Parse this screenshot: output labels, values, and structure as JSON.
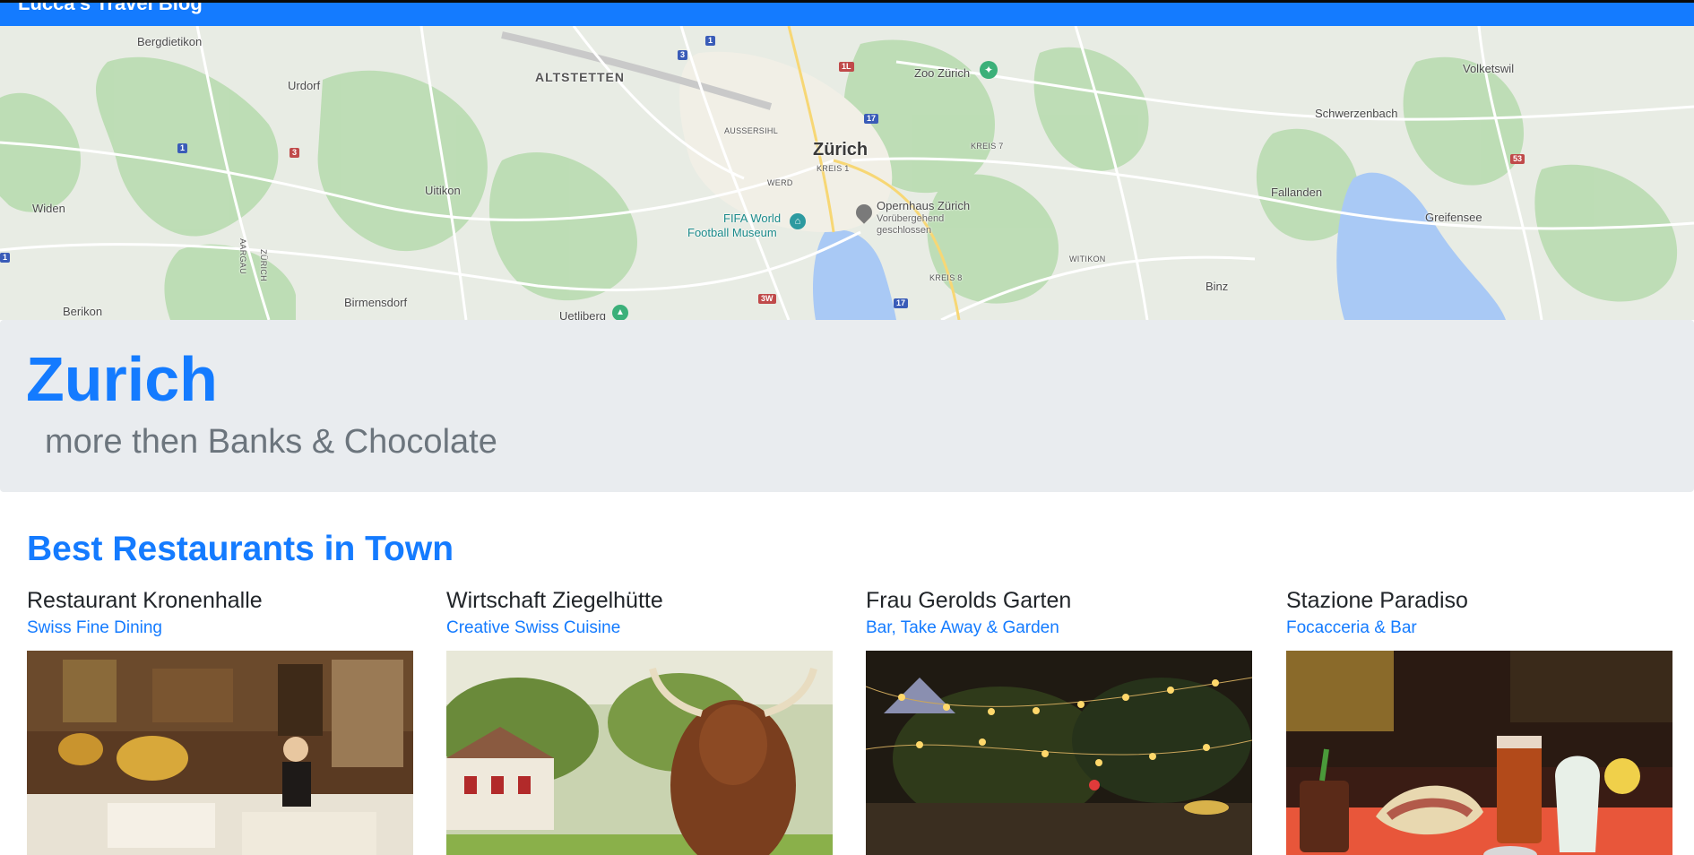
{
  "navbar": {
    "brand": "Lucca's Travel Blog"
  },
  "map": {
    "labels": {
      "bergdietikon": "Bergdietikon",
      "urdorf": "Urdorf",
      "altstetten": "ALTSTETTEN",
      "aussersihl": "AUSSERSIHL",
      "zurich": "Zürich",
      "kreis1": "KREIS 1",
      "werd": "WERD",
      "zoo": "Zoo Zürich",
      "kreis7": "KREIS 7",
      "schwerzenbach": "Schwerzenbach",
      "volketswil": "Volketswil",
      "widen": "Widen",
      "uitikon": "Uitikon",
      "fifa_line1": "FIFA World",
      "fifa_line2": "Football Museum",
      "opernhaus": "Opernhaus Zürich",
      "opernhaus_sub1": "Vorübergehend",
      "opernhaus_sub2": "geschlossen",
      "fallanden": "Fallanden",
      "greifensee": "Greifensee",
      "witikon": "WITIKON",
      "kreis8": "KREIS 8",
      "binz": "Binz",
      "berikon": "Berikon",
      "birmensdorf": "Birmensdorf",
      "uetliberg": "Uetliberg",
      "aargau": "AARGAU",
      "zurich_border": "ZÜRICH"
    },
    "shields": {
      "s1a": "1",
      "s3a": "3",
      "s1l": "1L",
      "s17a": "17",
      "s1b": "1",
      "s3b": "3",
      "s53": "53",
      "s3w": "3W",
      "s17b": "17",
      "s1c": "1"
    },
    "colors": {
      "terrain": "#e7ece3",
      "forest": "#b6dcae",
      "water": "#a9c9f5",
      "road": "#ffffff"
    }
  },
  "jumbotron": {
    "title": "Zurich",
    "subtitle": "more then Banks & Chocolate"
  },
  "section": {
    "title": "Best Restaurants in Town"
  },
  "restaurants": [
    {
      "name": "Restaurant Kronenhalle",
      "category": "Swiss Fine Dining",
      "image": "restaurant-interior-photo"
    },
    {
      "name": "Wirtschaft Ziegelhütte",
      "category": "Creative Swiss Cuisine",
      "image": "highland-cow-photo"
    },
    {
      "name": "Frau Gerolds Garten",
      "category": "Bar, Take Away & Garden",
      "image": "night-garden-lights-photo"
    },
    {
      "name": "Stazione Paradiso",
      "category": "Focacceria & Bar",
      "image": "focaccia-drinks-photo"
    }
  ],
  "theme": {
    "primary": "#147bff",
    "muted": "#6c757d",
    "jumbotron_bg": "#e9ecef"
  }
}
